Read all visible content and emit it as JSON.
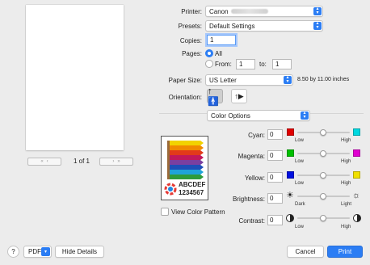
{
  "preview": {
    "page_count": "1 of 1",
    "first_icon": "first-page-icon",
    "prev_icon": "previous-page-icon",
    "next_icon": "next-page-icon",
    "last_icon": "last-page-icon"
  },
  "printer": {
    "label": "Printer:",
    "value": "Canon"
  },
  "presets": {
    "label": "Presets:",
    "value": "Default Settings"
  },
  "copies": {
    "label": "Copies:",
    "value": "1"
  },
  "pages": {
    "label": "Pages:",
    "all_label": "All",
    "from_label": "From:",
    "from_value": "1",
    "to_label": "to:",
    "to_value": "1",
    "selected": "All"
  },
  "paper_size": {
    "label": "Paper Size:",
    "value": "US Letter",
    "dimensions": "8.50 by 11.00 inches"
  },
  "orientation": {
    "label": "Orientation:",
    "selected": "portrait"
  },
  "section": {
    "value": "Color Options"
  },
  "sample": {
    "letters": "ABCDEF",
    "digits": "1234567"
  },
  "view_color_pattern": {
    "label": "View Color Pattern",
    "checked": false
  },
  "color": {
    "cyan": {
      "label": "Cyan:",
      "value": "0",
      "low": "Low",
      "high": "High",
      "low_color": "#e00000",
      "high_color": "#00d8e0"
    },
    "magenta": {
      "label": "Magenta:",
      "value": "0",
      "low": "Low",
      "high": "High",
      "low_color": "#00c000",
      "high_color": "#e000d0"
    },
    "yellow": {
      "label": "Yellow:",
      "value": "0",
      "low": "Low",
      "high": "High",
      "low_color": "#0010e0",
      "high_color": "#f0e000"
    },
    "brightness": {
      "label": "Brightness:",
      "value": "0",
      "low": "Dark",
      "high": "Light",
      "low_icon": "sun-dim-icon",
      "high_icon": "sun-bright-icon"
    },
    "contrast": {
      "label": "Contrast:",
      "value": "0",
      "low": "Low",
      "high": "High",
      "icon": "contrast-icon"
    }
  },
  "buttons": {
    "help": "?",
    "pdf": "PDF",
    "hide_details": "Hide Details",
    "cancel": "Cancel",
    "print": "Print"
  },
  "colors": {
    "accent": "#2b7df4",
    "background": "#ececec"
  }
}
